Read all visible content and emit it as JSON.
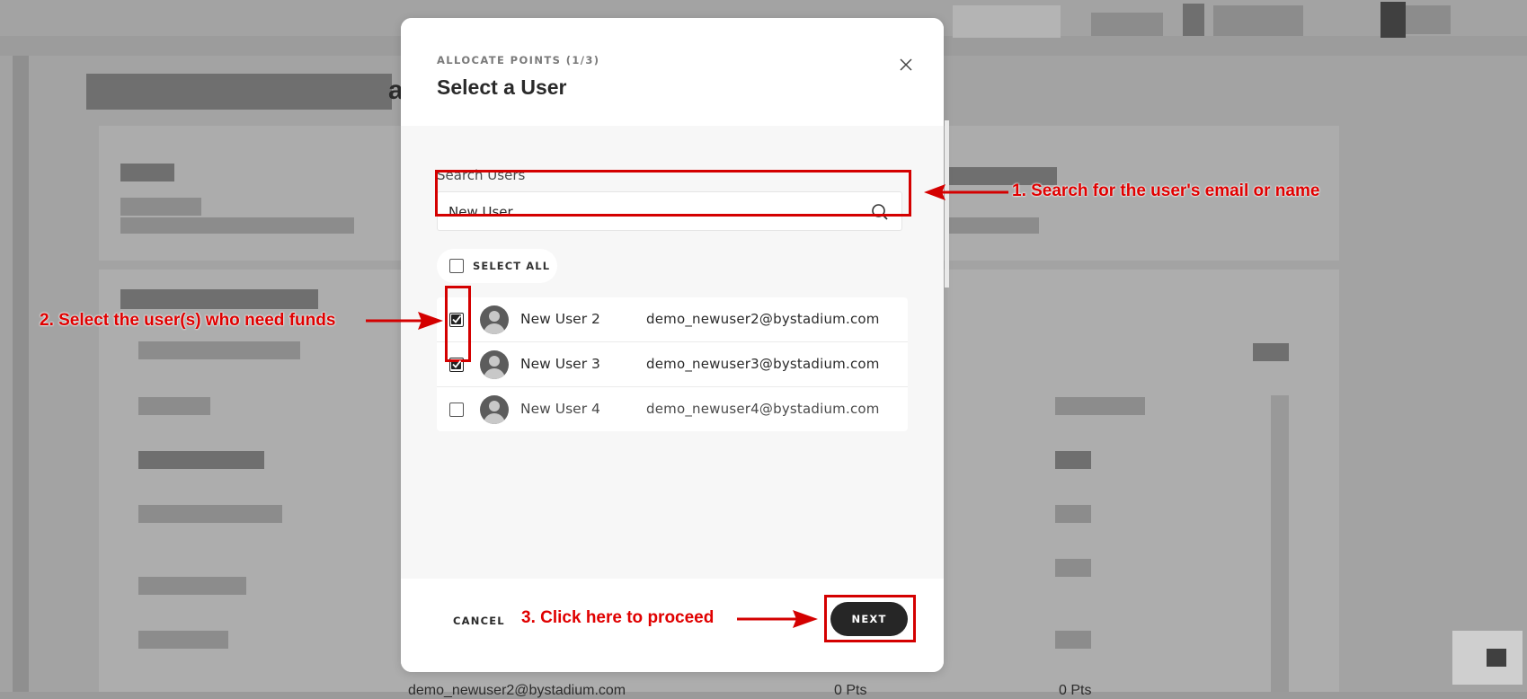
{
  "modal": {
    "eyebrow": "ALLOCATE POINTS (1/3)",
    "title": "Select a User",
    "close_icon": "close-icon"
  },
  "search": {
    "label": "Search Users",
    "value": "New User",
    "icon": "search-icon"
  },
  "select_all": {
    "label": "SELECT ALL",
    "checked": false
  },
  "users": [
    {
      "name": "New User 2",
      "email": "demo_newuser2@bystadium.com",
      "checked": true
    },
    {
      "name": "New User 3",
      "email": "demo_newuser3@bystadium.com",
      "checked": true
    },
    {
      "name": "New User 4",
      "email": "demo_newuser4@bystadium.com",
      "checked": false
    }
  ],
  "footer": {
    "cancel_label": "CANCEL",
    "next_label": "NEXT"
  },
  "background": {
    "partial_letter": "a",
    "email_fragment": "demo_newuser2@bystadium.com",
    "points_fragment": "0 Pts",
    "unit_fragment": "0 Pts"
  },
  "annotations": {
    "step1": "1. Search for the user's email or name",
    "step2": "2. Select the user(s) who need funds",
    "step3": "3. Click here to proceed",
    "color": "#e00000"
  }
}
